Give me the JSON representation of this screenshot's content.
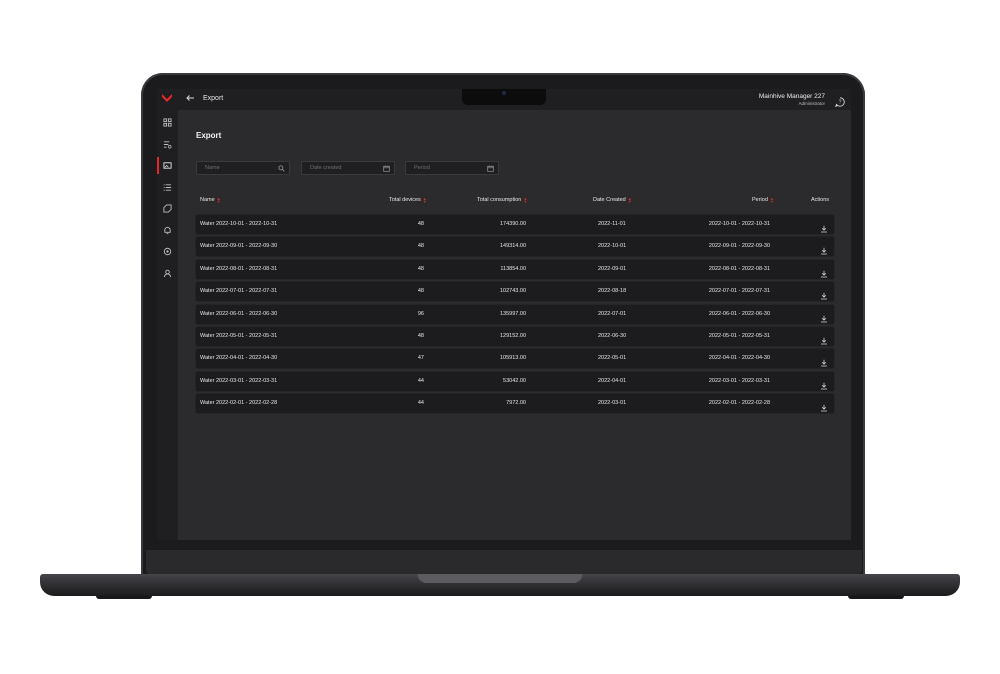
{
  "app": {
    "title": "Export",
    "user_name": "Mainhive Manager 227",
    "user_role": "Administrator"
  },
  "sidebar": {
    "items": [
      {
        "icon": "dashboard-icon"
      },
      {
        "icon": "list-settings-icon"
      },
      {
        "icon": "image-export-icon",
        "active": true
      },
      {
        "icon": "list-icon"
      },
      {
        "icon": "tag-icon"
      },
      {
        "icon": "bell-icon"
      },
      {
        "icon": "target-icon"
      },
      {
        "icon": "user-icon"
      }
    ]
  },
  "page": {
    "title": "Export"
  },
  "filters": {
    "name_placeholder": "Name",
    "date_created_placeholder": "Date created",
    "period_placeholder": "Period"
  },
  "table": {
    "headers": {
      "name": "Name",
      "total_devices": "Total devices",
      "total_consumption": "Total consumption",
      "date_created": "Date Created",
      "period": "Period",
      "actions": "Actions"
    },
    "rows": [
      {
        "name": "Water 2022-10-01 - 2022-10-31",
        "devices": "48",
        "consumption": "174390.00",
        "date_created": "2022-11-01",
        "period": "2022-10-01 - 2022-10-31"
      },
      {
        "name": "Water 2022-09-01 - 2022-09-30",
        "devices": "48",
        "consumption": "149314.00",
        "date_created": "2022-10-01",
        "period": "2022-09-01 - 2022-09-30"
      },
      {
        "name": "Water 2022-08-01 - 2022-08-31",
        "devices": "48",
        "consumption": "113854.00",
        "date_created": "2022-09-01",
        "period": "2022-08-01 - 2022-08-31"
      },
      {
        "name": "Water 2022-07-01 - 2022-07-31",
        "devices": "48",
        "consumption": "102743.00",
        "date_created": "2022-08-18",
        "period": "2022-07-01 - 2022-07-31"
      },
      {
        "name": "Water 2022-06-01 - 2022-06-30",
        "devices": "96",
        "consumption": "135997.00",
        "date_created": "2022-07-01",
        "period": "2022-06-01 - 2022-06-30"
      },
      {
        "name": "Water 2022-05-01 - 2022-05-31",
        "devices": "48",
        "consumption": "129152.00",
        "date_created": "2022-06-30",
        "period": "2022-05-01 - 2022-05-31"
      },
      {
        "name": "Water 2022-04-01 - 2022-04-30",
        "devices": "47",
        "consumption": "105913.00",
        "date_created": "2022-05-01",
        "period": "2022-04-01 - 2022-04-30"
      },
      {
        "name": "Water 2022-03-01 - 2022-03-31",
        "devices": "44",
        "consumption": "53042.00",
        "date_created": "2022-04-01",
        "period": "2022-03-01 - 2022-03-31"
      },
      {
        "name": "Water 2022-02-01 - 2022-02-28",
        "devices": "44",
        "consumption": "7972.00",
        "date_created": "2022-03-01",
        "period": "2022-02-01 - 2022-02-28"
      }
    ]
  },
  "colors": {
    "accent": "#e02a2a",
    "background": "#2b2b2d",
    "panel": "#1f1f21",
    "row": "#1c1c1e"
  }
}
